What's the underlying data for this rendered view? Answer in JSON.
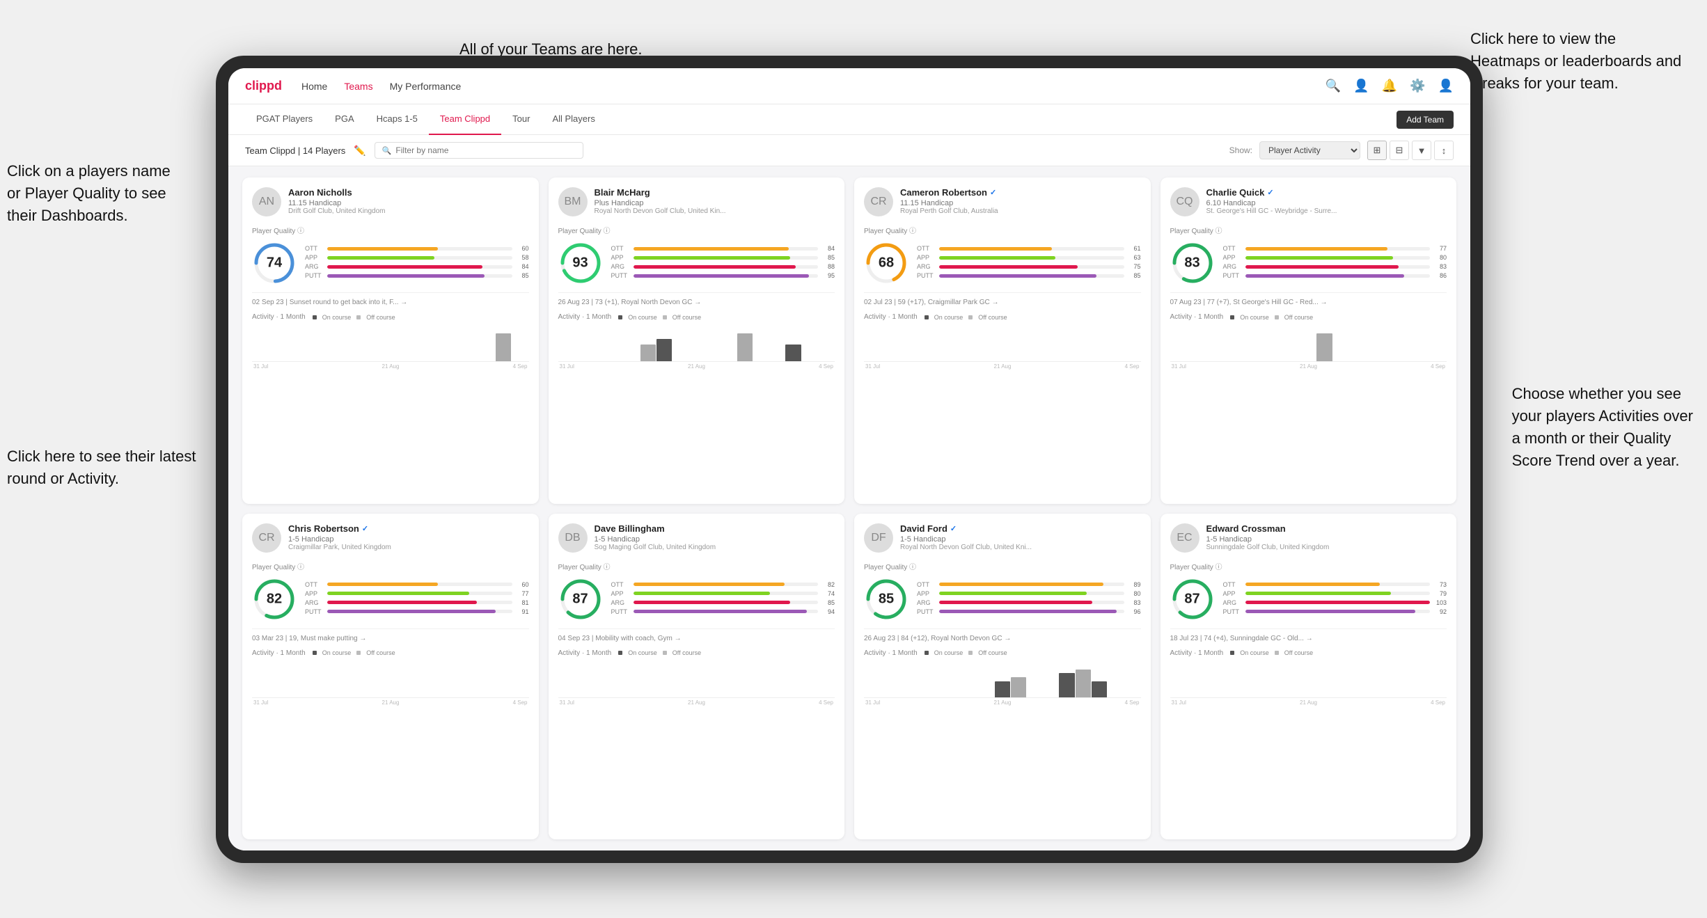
{
  "app": {
    "logo": "clippd",
    "nav_items": [
      "Home",
      "Teams",
      "My Performance"
    ],
    "nav_icons": [
      "search",
      "person",
      "bell",
      "settings",
      "avatar"
    ],
    "sub_nav": [
      "PGAT Players",
      "PGA",
      "Hcaps 1-5",
      "Team Clippd",
      "Tour",
      "All Players"
    ],
    "active_sub_nav": "Team Clippd",
    "add_team_label": "Add Team"
  },
  "team_bar": {
    "title": "Team Clippd | 14 Players",
    "search_placeholder": "Filter by name",
    "show_label": "Show:",
    "show_value": "Player Activity",
    "view_modes": [
      "grid4",
      "grid3",
      "filter",
      "sort"
    ]
  },
  "annotations": {
    "top_teams": "All of your Teams are here.",
    "top_right": "Click here to view the\nHeatmaps or leaderboards\nand streaks for your team.",
    "left_name": "Click on a players name\nor Player Quality to see\ntheir Dashboards.",
    "bottom_left": "Click here to see their latest\nround or Activity.",
    "bottom_right": "Choose whether you see\nyour players Activities over\na month or their Quality\nScore Trend over a year."
  },
  "players": [
    {
      "name": "Aaron Nicholls",
      "handicap": "11.15 Handicap",
      "club": "Drift Golf Club, United Kingdom",
      "quality": 74,
      "quality_color": "#4A90D9",
      "verified": false,
      "ott": 60,
      "app": 58,
      "arg": 84,
      "putt": 85,
      "latest_round": "02 Sep 23 | Sunset round to get back into it, F... →",
      "chart_data": [
        0,
        0,
        0,
        0,
        0,
        0,
        0,
        0,
        0,
        0,
        0,
        0,
        0,
        0,
        0,
        2,
        0
      ],
      "dates": [
        "31 Jul",
        "21 Aug",
        "4 Sep"
      ]
    },
    {
      "name": "Blair McHarg",
      "handicap": "Plus Handicap",
      "club": "Royal North Devon Golf Club, United Kin...",
      "quality": 93,
      "quality_color": "#2ECC71",
      "verified": false,
      "ott": 84,
      "app": 85,
      "arg": 88,
      "putt": 95,
      "latest_round": "26 Aug 23 | 73 (+1), Royal North Devon GC →",
      "chart_data": [
        0,
        0,
        0,
        0,
        0,
        3,
        4,
        0,
        0,
        0,
        0,
        5,
        0,
        0,
        3,
        0,
        0
      ],
      "dates": [
        "31 Jul",
        "21 Aug",
        "4 Sep"
      ]
    },
    {
      "name": "Cameron Robertson",
      "handicap": "11.15 Handicap",
      "club": "Royal Perth Golf Club, Australia",
      "quality": 68,
      "quality_color": "#F39C12",
      "verified": true,
      "ott": 61,
      "app": 63,
      "arg": 75,
      "putt": 85,
      "latest_round": "02 Jul 23 | 59 (+17), Craigmillar Park GC →",
      "chart_data": [
        0,
        0,
        0,
        0,
        0,
        0,
        0,
        0,
        0,
        0,
        0,
        0,
        0,
        0,
        0,
        0,
        0
      ],
      "dates": [
        "31 Jul",
        "21 Aug",
        "4 Sep"
      ]
    },
    {
      "name": "Charlie Quick",
      "handicap": "6.10 Handicap",
      "club": "St. George's Hill GC - Weybridge - Surre...",
      "quality": 83,
      "quality_color": "#27AE60",
      "verified": true,
      "ott": 77,
      "app": 80,
      "arg": 83,
      "putt": 86,
      "latest_round": "07 Aug 23 | 77 (+7), St George's Hill GC - Red... →",
      "chart_data": [
        0,
        0,
        0,
        0,
        0,
        0,
        0,
        0,
        0,
        2,
        0,
        0,
        0,
        0,
        0,
        0,
        0
      ],
      "dates": [
        "31 Jul",
        "21 Aug",
        "4 Sep"
      ]
    },
    {
      "name": "Chris Robertson",
      "handicap": "1-5 Handicap",
      "club": "Craigmillar Park, United Kingdom",
      "quality": 82,
      "quality_color": "#27AE60",
      "verified": true,
      "ott": 60,
      "app": 77,
      "arg": 81,
      "putt": 91,
      "latest_round": "03 Mar 23 | 19, Must make putting →",
      "chart_data": [
        0,
        0,
        0,
        0,
        0,
        0,
        0,
        0,
        0,
        0,
        0,
        0,
        0,
        0,
        0,
        0,
        0
      ],
      "dates": [
        "31 Jul",
        "21 Aug",
        "4 Sep"
      ]
    },
    {
      "name": "Dave Billingham",
      "handicap": "1-5 Handicap",
      "club": "Sog Maging Golf Club, United Kingdom",
      "quality": 87,
      "quality_color": "#27AE60",
      "verified": false,
      "ott": 82,
      "app": 74,
      "arg": 85,
      "putt": 94,
      "latest_round": "04 Sep 23 | Mobility with coach, Gym →",
      "chart_data": [
        0,
        0,
        0,
        0,
        0,
        0,
        0,
        0,
        0,
        0,
        0,
        0,
        0,
        0,
        0,
        0,
        0
      ],
      "dates": [
        "31 Jul",
        "21 Aug",
        "4 Sep"
      ]
    },
    {
      "name": "David Ford",
      "handicap": "1-5 Handicap",
      "club": "Royal North Devon Golf Club, United Kni...",
      "quality": 85,
      "quality_color": "#27AE60",
      "verified": true,
      "ott": 89,
      "app": 80,
      "arg": 83,
      "putt": 96,
      "latest_round": "26 Aug 23 | 84 (+12), Royal North Devon GC →",
      "chart_data": [
        0,
        0,
        0,
        0,
        0,
        0,
        0,
        0,
        4,
        5,
        0,
        0,
        6,
        7,
        4,
        0,
        0
      ],
      "dates": [
        "31 Jul",
        "21 Aug",
        "4 Sep"
      ]
    },
    {
      "name": "Edward Crossman",
      "handicap": "1-5 Handicap",
      "club": "Sunningdale Golf Club, United Kingdom",
      "quality": 87,
      "quality_color": "#27AE60",
      "verified": false,
      "ott": 73,
      "app": 79,
      "arg": 103,
      "putt": 92,
      "latest_round": "18 Jul 23 | 74 (+4), Sunningdale GC - Old... →",
      "chart_data": [
        0,
        0,
        0,
        0,
        0,
        0,
        0,
        0,
        0,
        0,
        0,
        0,
        0,
        0,
        0,
        0,
        0
      ],
      "dates": [
        "31 Jul",
        "21 Aug",
        "4 Sep"
      ]
    }
  ],
  "bar_colors": {
    "ott": "#F5A623",
    "app": "#7ED321",
    "arg": "#E0184D",
    "putt": "#9B59B6"
  },
  "chart_colors": {
    "on_course": "#555",
    "off_course": "#aaa"
  }
}
